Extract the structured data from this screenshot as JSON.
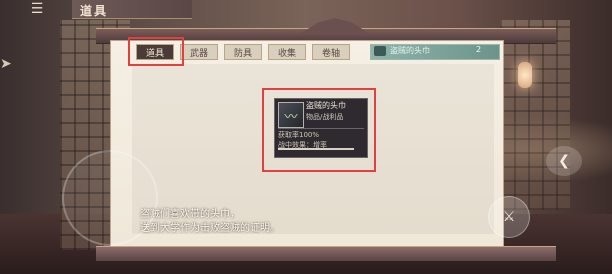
{
  "header": {
    "title": "道具"
  },
  "tabs": [
    {
      "label": "道具",
      "active": true
    },
    {
      "label": "武器",
      "active": false
    },
    {
      "label": "防具",
      "active": false
    },
    {
      "label": "收集",
      "active": false
    },
    {
      "label": "卷轴",
      "active": false
    }
  ],
  "item_list": [
    {
      "name": "盗贼的头巾",
      "count": "2"
    }
  ],
  "tooltip": {
    "name": "盗贼的头巾",
    "type": "物品/战利品",
    "rate": "获取率100%",
    "bonus": "战中效果：增率"
  },
  "description": {
    "line1": "盗贼们喜欢带的头巾，",
    "line2": "送到大学作为击败盗贼的证明。"
  },
  "icons": {
    "menu": "menu-icon",
    "item": "scarf-icon",
    "right_button": "chevron-left-icon",
    "action_button": "sword-icon"
  },
  "colors": {
    "highlight_border": "#e0413f",
    "active_tab_bg": "#4b3b38",
    "panel_bg": "#f5efe4",
    "item_entry_bg": "#8db4a9"
  }
}
